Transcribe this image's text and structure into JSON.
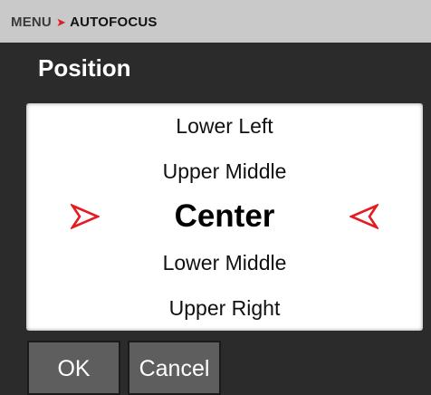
{
  "breadcrumb": {
    "parent": "MENU",
    "separator": "➤",
    "current": "AUTOFOCUS"
  },
  "title": "Position",
  "picker": {
    "options": [
      "Lower Left",
      "Upper Middle",
      "Center",
      "Lower Middle",
      "Upper Right"
    ],
    "selected": "Center",
    "arrow_color": "#e31b23"
  },
  "buttons": {
    "ok": "OK",
    "cancel": "Cancel"
  },
  "colors": {
    "accent": "#e31b23",
    "header_bg": "#c9c9c9",
    "background": "#2b2b2b",
    "button_bg": "#5e5e5e"
  }
}
